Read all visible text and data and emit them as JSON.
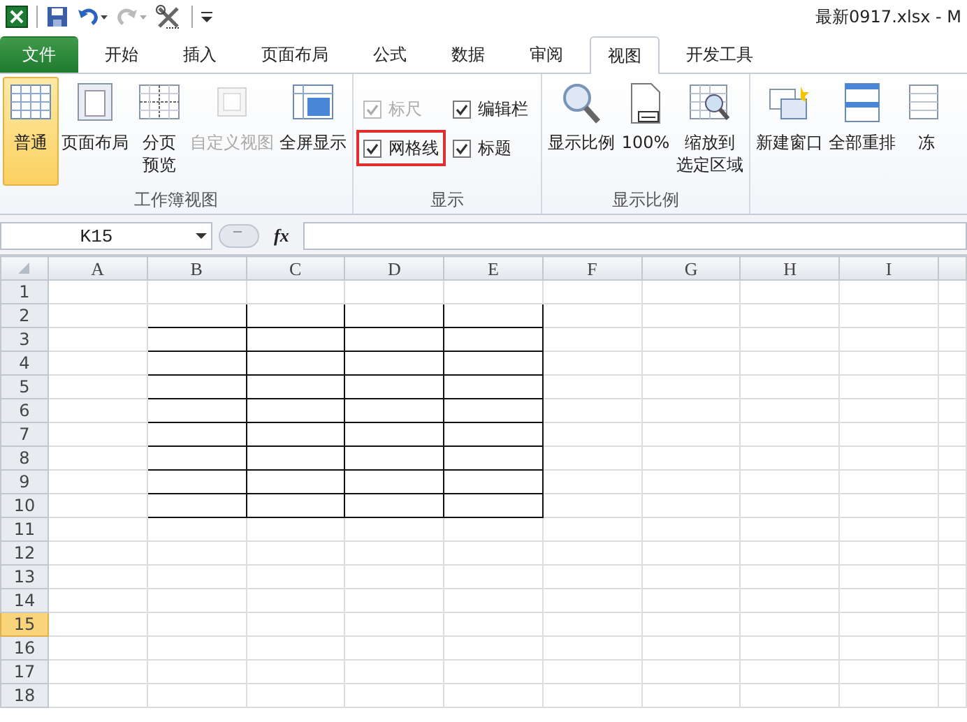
{
  "window": {
    "title": "最新0917.xlsx  -  M"
  },
  "quick_access": {
    "redo_disabled": true
  },
  "tabs": [
    {
      "label": "文件",
      "kind": "file",
      "selected": false
    },
    {
      "label": "开始",
      "kind": "tab",
      "selected": false
    },
    {
      "label": "插入",
      "kind": "tab",
      "selected": false
    },
    {
      "label": "页面布局",
      "kind": "tab",
      "selected": false
    },
    {
      "label": "公式",
      "kind": "tab",
      "selected": false
    },
    {
      "label": "数据",
      "kind": "tab",
      "selected": false
    },
    {
      "label": "审阅",
      "kind": "tab",
      "selected": false
    },
    {
      "label": "视图",
      "kind": "tab",
      "selected": true
    },
    {
      "label": "开发工具",
      "kind": "tab",
      "selected": false
    }
  ],
  "ribbon_groups": [
    {
      "label": "工作簿视图",
      "kind": "buttons",
      "items": [
        {
          "label": "普通",
          "selected": true,
          "disabled": false
        },
        {
          "label": "页面布局",
          "selected": false,
          "disabled": false
        },
        {
          "lines": [
            "分页",
            "预览"
          ],
          "selected": false,
          "disabled": false
        },
        {
          "label": "自定义视图",
          "selected": false,
          "disabled": true
        },
        {
          "label": "全屏显示",
          "selected": false,
          "disabled": false
        }
      ]
    },
    {
      "label": "显示",
      "kind": "checks",
      "items": [
        {
          "label": "标尺",
          "checked": true,
          "disabled": true,
          "highlighted": false
        },
        {
          "label": "编辑栏",
          "checked": true,
          "disabled": false,
          "highlighted": false
        },
        {
          "label": "网格线",
          "checked": true,
          "disabled": false,
          "highlighted": true
        },
        {
          "label": "标题",
          "checked": true,
          "disabled": false,
          "highlighted": false
        }
      ]
    },
    {
      "label": "显示比例",
      "kind": "buttons",
      "items": [
        {
          "label": "显示比例",
          "selected": false,
          "disabled": false
        },
        {
          "label": "100%",
          "selected": false,
          "disabled": false
        },
        {
          "lines": [
            "缩放到",
            "选定区域"
          ],
          "selected": false,
          "disabled": false
        }
      ]
    },
    {
      "kind": "buttons",
      "items": [
        {
          "label": "新建窗口",
          "selected": false,
          "disabled": false
        },
        {
          "label": "全部重排",
          "selected": false,
          "disabled": false
        },
        {
          "label": "冻",
          "selected": false,
          "disabled": false
        }
      ]
    }
  ],
  "formula_bar": {
    "name_box": "K15",
    "fx_label": "fx"
  },
  "sheet": {
    "columns": [
      {
        "label": "A",
        "bordered": false
      },
      {
        "label": "B",
        "bordered": true
      },
      {
        "label": "C",
        "bordered": true
      },
      {
        "label": "D",
        "bordered": true
      },
      {
        "label": "E",
        "bordered": true
      },
      {
        "label": "F",
        "bordered": false
      },
      {
        "label": "G",
        "bordered": false
      },
      {
        "label": "H",
        "bordered": false
      },
      {
        "label": "I",
        "bordered": false
      }
    ],
    "rows": [
      {
        "label": "1",
        "bordered": false,
        "selected": false
      },
      {
        "label": "2",
        "bordered": true,
        "selected": false
      },
      {
        "label": "3",
        "bordered": true,
        "selected": false
      },
      {
        "label": "4",
        "bordered": true,
        "selected": false
      },
      {
        "label": "5",
        "bordered": true,
        "selected": false
      },
      {
        "label": "6",
        "bordered": true,
        "selected": false
      },
      {
        "label": "7",
        "bordered": true,
        "selected": false
      },
      {
        "label": "8",
        "bordered": true,
        "selected": false
      },
      {
        "label": "9",
        "bordered": true,
        "selected": false
      },
      {
        "label": "10",
        "bordered": true,
        "selected": false
      },
      {
        "label": "11",
        "bordered": false,
        "selected": false
      },
      {
        "label": "12",
        "bordered": false,
        "selected": false
      },
      {
        "label": "13",
        "bordered": false,
        "selected": false
      },
      {
        "label": "14",
        "bordered": false,
        "selected": false
      },
      {
        "label": "15",
        "bordered": false,
        "selected": true
      },
      {
        "label": "16",
        "bordered": false,
        "selected": false
      },
      {
        "label": "17",
        "bordered": false,
        "selected": false
      },
      {
        "label": "18",
        "bordered": false,
        "selected": false
      }
    ]
  }
}
